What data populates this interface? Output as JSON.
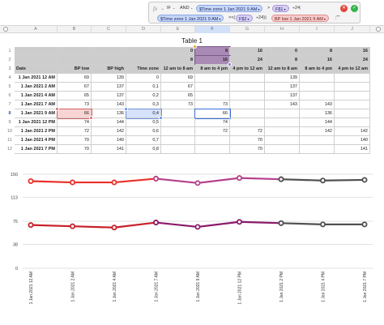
{
  "formula_bar": {
    "fx_label": "fx",
    "caret": "⌄",
    "if_label": "IF",
    "and_label": "AND",
    "tok_time_zone_1": "$Time zone 1 Jan 2021 9 AM",
    "op_gt": ">",
    "tok_f1": "F$1",
    "op_div1": "÷24;",
    "tok_time_zone_2": "$Time zone 1 Jan 2021 9 AM",
    "op_lt": "×<(",
    "tok_f2": "F$2",
    "op_div2": "÷24))",
    "tok_bp_low": "BP low 1 Jan 2021 9 AM",
    "op_end": ";\"\"",
    "cancel": "✕",
    "confirm": "✓"
  },
  "columns": [
    "A",
    "B",
    "C",
    "D",
    "E",
    "F",
    "G",
    "H",
    "I",
    "J"
  ],
  "selected_column": "F",
  "table_title": "Table 1",
  "row_numbers": [
    "1",
    "2",
    "3",
    "4",
    "5",
    "6",
    "7",
    "8",
    "9",
    "10",
    "11",
    "12"
  ],
  "header_row1": [
    "",
    "",
    "",
    "",
    "0",
    "8",
    "16",
    "0",
    "8",
    "16"
  ],
  "header_row2": [
    "",
    "",
    "",
    "",
    "8",
    "16",
    "24",
    "8",
    "16",
    "24"
  ],
  "header_row3": [
    "Date",
    "BP low",
    "BP high",
    "Time zone",
    "12 am to 8 am",
    "8 am to 4 pm",
    "4 pm to 12 am",
    "12 am to 8 am",
    "8 am to 4 pm",
    "4 pm to 12 am"
  ],
  "rows": [
    [
      "1 Jan 2021 12 AM",
      "69",
      "139",
      "0",
      "69",
      "",
      "",
      "139",
      "",
      ""
    ],
    [
      "1 Jan 2021 2 AM",
      "67",
      "137",
      "0,1",
      "67",
      "",
      "",
      "137",
      "",
      ""
    ],
    [
      "1 Jan 2021 4 AM",
      "65",
      "137",
      "0,2",
      "65",
      "",
      "",
      "137",
      "",
      ""
    ],
    [
      "1 Jan 2021 7 AM",
      "73",
      "143",
      "0,3",
      "73",
      "73",
      "",
      "143",
      "143",
      ""
    ],
    [
      "1 Jan 2021 9 AM",
      "66",
      "136",
      "0,4",
      "",
      "66",
      "",
      "",
      "136",
      ""
    ],
    [
      "1 Jan 2021 12 PM",
      "74",
      "144",
      "0,5",
      "",
      "74",
      "",
      "",
      "144",
      ""
    ],
    [
      "1 Jan 2021 2 PM",
      "72",
      "142",
      "0,6",
      "",
      "72",
      "72",
      "",
      "142",
      "142"
    ],
    [
      "1 Jan 2021 4 PM",
      "70",
      "140",
      "0,7",
      "",
      "",
      "70",
      "",
      "",
      "140"
    ],
    [
      "1 Jan 2021 7 PM",
      "70",
      "141",
      "0,8",
      "",
      "",
      "70",
      "",
      "",
      "141"
    ]
  ],
  "chart_data": {
    "type": "line",
    "categories": [
      "1 Jan 2021 12 AM",
      "1 Jan 2021 2 AM",
      "1 Jan 2021 4 AM",
      "1 Jan 2021 7 AM",
      "1 Jan 2021 9 AM",
      "1 Jan 2021 12 PM",
      "1 Jan 2021 2 PM",
      "1 Jan 2021 4 PM",
      "1 Jan 2021 7 PM"
    ],
    "ylim": [
      0,
      150
    ],
    "yticks": [
      0,
      38,
      75,
      113,
      150
    ],
    "grid": true,
    "segments": [
      {
        "color": "#e8302a",
        "from": 0,
        "to": 3,
        "values": [
          139,
          137,
          137,
          143
        ]
      },
      {
        "color": "#b5408c",
        "from": 3,
        "to": 6,
        "values": [
          143,
          136,
          144,
          142
        ]
      },
      {
        "color": "#505050",
        "from": 6,
        "to": 8,
        "values": [
          142,
          140,
          141
        ]
      },
      {
        "color": "#c8202a",
        "from": 0,
        "to": 3,
        "values": [
          69,
          67,
          65,
          73
        ]
      },
      {
        "color": "#8a1a6a",
        "from": 3,
        "to": 6,
        "values": [
          73,
          66,
          74,
          72
        ]
      },
      {
        "color": "#505050",
        "from": 6,
        "to": 8,
        "values": [
          72,
          70,
          70
        ]
      }
    ]
  }
}
